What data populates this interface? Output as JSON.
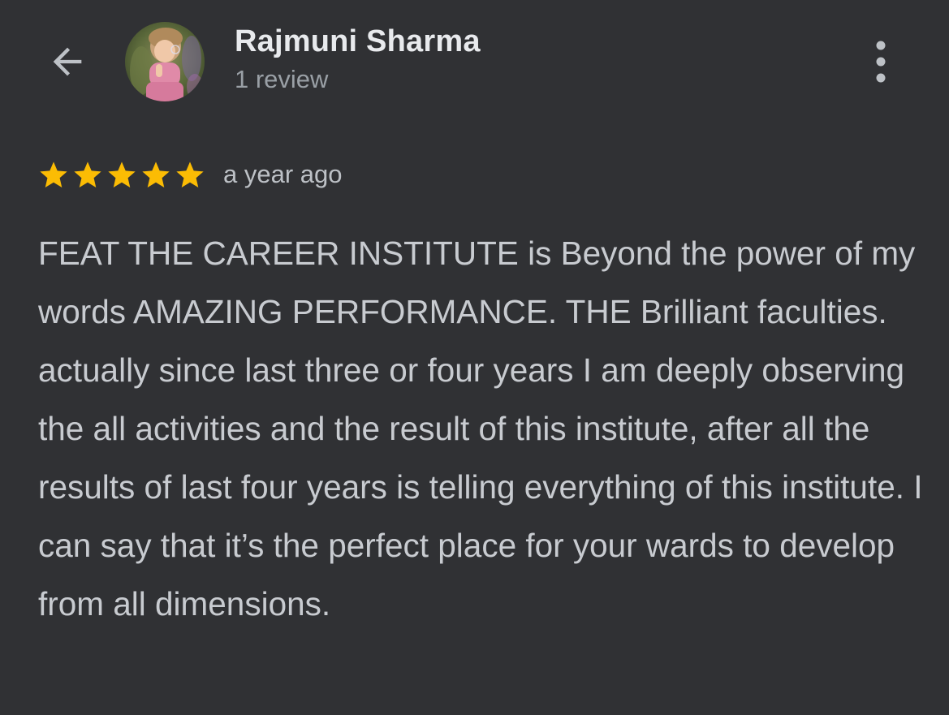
{
  "header": {
    "back_icon": "arrow-left-icon",
    "avatar_icon": "avatar-photo",
    "reviewer_name": "Rajmuni Sharma",
    "review_count": "1 review",
    "more_icon": "more-vert-icon"
  },
  "review": {
    "rating": 5,
    "rating_max": 5,
    "star_color": "#fbbc04",
    "date": "a year ago",
    "text": "FEAT THE CAREER INSTITUTE is Beyond the power of my words AMAZING PERFORMANCE. THE Brilliant faculties. actually since last three or four years I am deeply observing the all activities and the result of this institute, after all the results of last four years is telling everything of this institute. I can say that it’s the perfect place for your wards to develop from all dimensions."
  },
  "colors": {
    "background": "#303134",
    "primary_text": "#e8eaed",
    "secondary_text": "#9aa0a6",
    "body_text": "#c8cbd0"
  }
}
